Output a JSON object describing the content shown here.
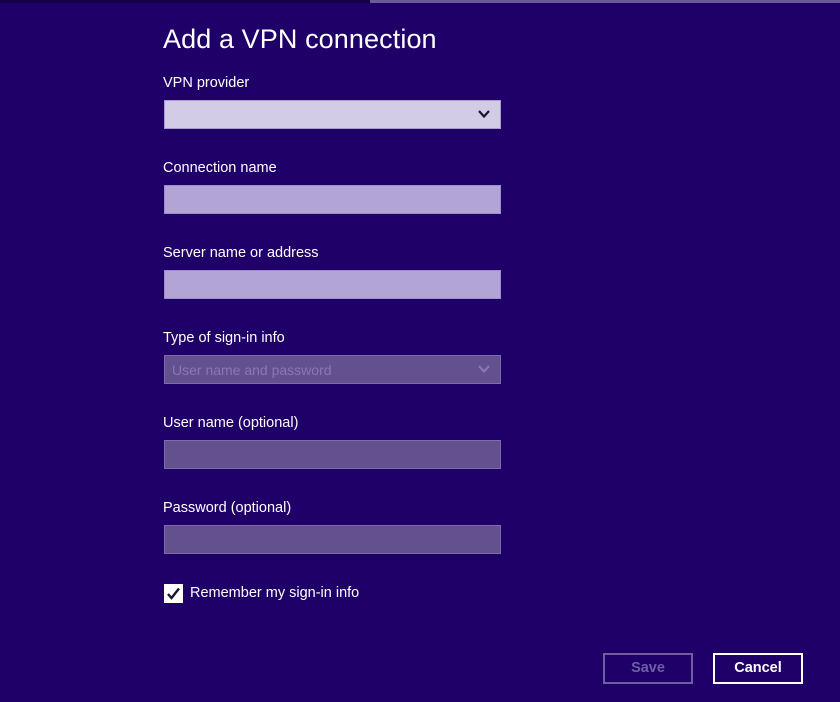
{
  "dialog": {
    "title": "Add a VPN connection"
  },
  "fields": {
    "vpn_provider": {
      "label": "VPN provider",
      "value": ""
    },
    "connection_name": {
      "label": "Connection name",
      "value": ""
    },
    "server": {
      "label": "Server name or address",
      "value": ""
    },
    "sign_in_type": {
      "label": "Type of sign-in info",
      "value": "User name and password"
    },
    "username": {
      "label": "User name (optional)",
      "value": ""
    },
    "password": {
      "label": "Password (optional)",
      "value": ""
    }
  },
  "remember": {
    "label": "Remember my sign-in info",
    "checked": true
  },
  "buttons": {
    "save": "Save",
    "cancel": "Cancel"
  },
  "icons": {
    "dropdown": "chevron-down-icon",
    "check": "checkmark-icon"
  },
  "colors": {
    "background": "#1f0068",
    "input_active": "#b2a5d6",
    "input_disabled": "#62508f",
    "select_active": "#d3cce6"
  }
}
